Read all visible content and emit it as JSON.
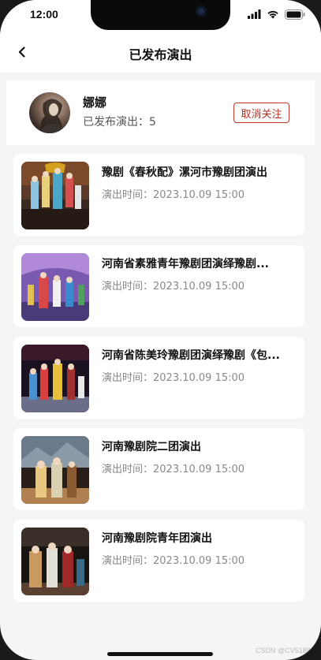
{
  "status_bar": {
    "time": "12:00",
    "icons": [
      "signal-icon",
      "wifi-icon",
      "battery-icon"
    ]
  },
  "nav": {
    "back_icon": "chevron-left-icon",
    "title": "已发布演出"
  },
  "profile": {
    "name": "娜娜",
    "published_count": "已发布演出：5",
    "unfollow_label": "取消关注",
    "accent_color": "#c0392b"
  },
  "shows": [
    {
      "title": "豫剧《春秋配》漯河市豫剧团演出",
      "time": "演出时间：2023.10.09 15:00"
    },
    {
      "title": "河南省素雅青年豫剧团演绎豫剧...",
      "time": "演出时间：2023.10.09 15:00"
    },
    {
      "title": "河南省陈美玲豫剧团演绎豫剧《包...",
      "time": "演出时间：2023.10.09 15:00"
    },
    {
      "title": "河南豫剧院二团演出",
      "time": "演出时间：2023.10.09 15:00"
    },
    {
      "title": "河南豫剧院青年团演出",
      "time": "演出时间：2023.10.09 15:00"
    }
  ],
  "watermark": "CSDN @CV5188"
}
